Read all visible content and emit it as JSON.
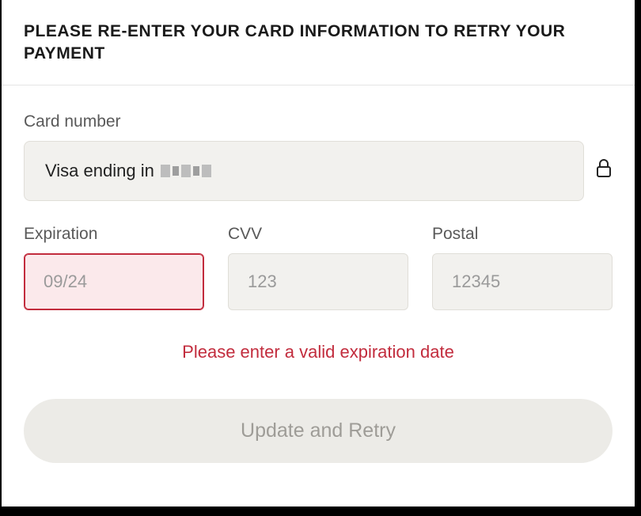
{
  "header": {
    "title": "PLEASE RE-ENTER YOUR CARD INFORMATION TO RETRY YOUR PAYMENT"
  },
  "card": {
    "label": "Card number",
    "display_prefix": "Visa ending in"
  },
  "expiration": {
    "label": "Expiration",
    "placeholder": "09/24"
  },
  "cvv": {
    "label": "CVV",
    "placeholder": "123"
  },
  "postal": {
    "label": "Postal",
    "placeholder": "12345"
  },
  "error_message": "Please enter a valid expiration date",
  "submit": {
    "label": "Update and Retry"
  }
}
